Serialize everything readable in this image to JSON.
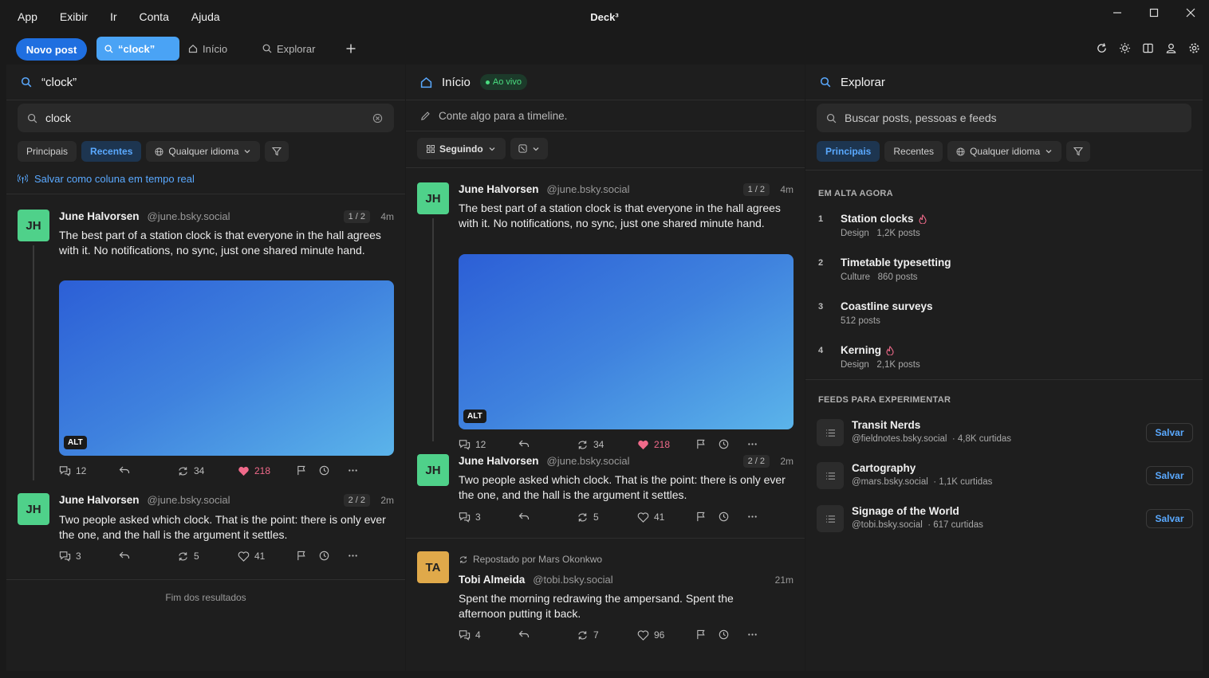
{
  "menu": [
    "App",
    "Exibir",
    "Ir",
    "Conta",
    "Ajuda"
  ],
  "app_title": "Deck³",
  "toolbar": {
    "new_post": "Novo post",
    "tabs": [
      {
        "label": "“clock”",
        "icon": "search-icon",
        "active": true
      },
      {
        "label": "Início",
        "icon": "home-icon"
      },
      {
        "label": "Explorar",
        "icon": "search-icon"
      }
    ],
    "add_tab_icon": "plus-icon",
    "right_icons": [
      "refresh-icon",
      "theme-icon",
      "columns-icon",
      "account-icon",
      "settings-icon"
    ]
  },
  "colors": {
    "accent": "#1f6fe0",
    "active_tab": "#4aa3f5",
    "like": "#f06a8a",
    "live": "#4ade80",
    "link": "#5aa9ff"
  },
  "search_column": {
    "title": "“clock”",
    "query": "clock",
    "filters": [
      "Principais",
      "Recentes"
    ],
    "active_filter": "Recentes",
    "language": "Qualquer idioma",
    "save_live": "Salvar como coluna em tempo real",
    "posts": [
      {
        "initials": "JH",
        "name": "June Halvorsen",
        "handle": "@june.bsky.social",
        "count": "1 / 2",
        "time": "4m",
        "text": "The best part of a station clock is that everyone in the hall agrees with it. No notifications, no sync, just one shared minute hand.",
        "alt": "ALT",
        "replies": "12",
        "reposts": "34",
        "likes": "218",
        "liked": true
      },
      {
        "initials": "JH",
        "name": "June Halvorsen",
        "handle": "@june.bsky.social",
        "count": "2 / 2",
        "time": "2m",
        "text": "Two people asked which clock. That is the point: there is only ever the one, and the hall is the argument it settles.",
        "replies": "3",
        "reposts": "5",
        "likes": "41",
        "liked": false
      }
    ],
    "end_text": "Fim dos resultados"
  },
  "home_column": {
    "title": "Início",
    "live": "Ao vivo",
    "compose_placeholder": "Conte algo para a timeline.",
    "feed_selector": "Seguindo",
    "posts": [
      {
        "initials": "JH",
        "name": "June Halvorsen",
        "handle": "@june.bsky.social",
        "count": "1 / 2",
        "time": "4m",
        "text": "The best part of a station clock is that everyone in the hall agrees with it. No notifications, no sync, just one shared minute hand.",
        "alt": "ALT",
        "replies": "12",
        "reposts": "34",
        "likes": "218",
        "liked": true
      },
      {
        "initials": "JH",
        "name": "June Halvorsen",
        "handle": "@june.bsky.social",
        "count": "2 / 2",
        "time": "2m",
        "text": "Two people asked which clock. That is the point: there is only ever the one, and the hall is the argument it settles.",
        "replies": "3",
        "reposts": "5",
        "likes": "41",
        "liked": false
      },
      {
        "initials": "TA",
        "name": "Tobi Almeida",
        "handle": "@tobi.bsky.social",
        "time": "21m",
        "repost_by": "Repostado por Mars Okonkwo",
        "text": "Spent the morning redrawing the ampersand. Spent the afternoon putting it back.",
        "replies": "4",
        "reposts": "7",
        "likes": "96",
        "liked": false
      }
    ]
  },
  "explore_column": {
    "title": "Explorar",
    "search_placeholder": "Buscar posts, pessoas e feeds",
    "filters": [
      "Principais",
      "Recentes"
    ],
    "active_filter": "Principais",
    "language": "Qualquer idioma",
    "trending_title": "EM ALTA AGORA",
    "trending": [
      {
        "rank": "1",
        "title": "Station clocks",
        "hot": true,
        "meta": "Design   1,2K posts"
      },
      {
        "rank": "2",
        "title": "Timetable typesetting",
        "hot": false,
        "meta": "Culture   860 posts"
      },
      {
        "rank": "3",
        "title": "Coastline surveys",
        "hot": false,
        "meta": "512 posts"
      },
      {
        "rank": "4",
        "title": "Kerning",
        "hot": true,
        "meta": "Design   2,1K posts"
      }
    ],
    "feeds_title": "FEEDS PARA EXPERIMENTAR",
    "feeds": [
      {
        "name": "Transit Nerds",
        "meta": "@fieldnotes.bsky.social  · 4,8K curtidas",
        "save": "Salvar"
      },
      {
        "name": "Cartography",
        "meta": "@mars.bsky.social  · 1,1K curtidas",
        "save": "Salvar"
      },
      {
        "name": "Signage of the World",
        "meta": "@tobi.bsky.social  · 617 curtidas",
        "save": "Salvar"
      }
    ]
  }
}
